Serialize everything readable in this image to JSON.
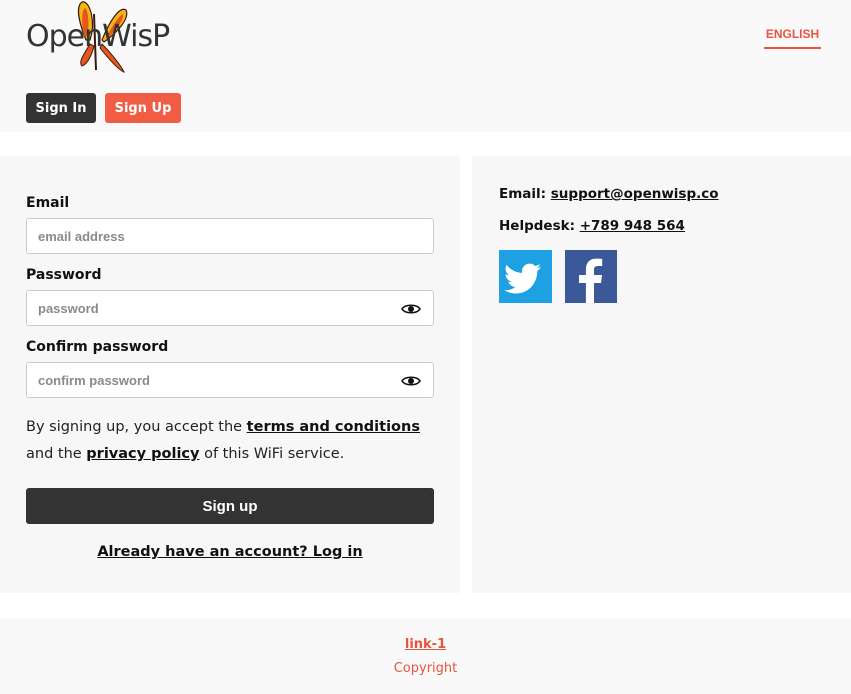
{
  "header": {
    "logo_text": "OpenWisP",
    "language": "ENGLISH",
    "nav": {
      "signin": "Sign In",
      "signup": "Sign Up"
    }
  },
  "form": {
    "email": {
      "label": "Email",
      "placeholder": "email address"
    },
    "password": {
      "label": "Password",
      "placeholder": "password"
    },
    "confirm": {
      "label": "Confirm password",
      "placeholder": "confirm password"
    },
    "terms": {
      "prefix": "By signing up, you accept the ",
      "terms_link": "terms and conditions",
      "middle": " and the ",
      "privacy_link": "privacy policy",
      "suffix": " of this WiFi service."
    },
    "submit": "Sign up",
    "login_link": "Already have an account? Log in"
  },
  "contact": {
    "email_label": "Email:",
    "email_value": "support@openwisp.co",
    "helpdesk_label": "Helpdesk:",
    "helpdesk_value": "+789 948 564",
    "social": {
      "twitter_icon": "twitter-icon",
      "facebook_icon": "facebook-icon"
    }
  },
  "footer": {
    "link": "link-1",
    "copyright": "Copyright"
  },
  "colors": {
    "accent": "#f05c44",
    "dark": "#333333",
    "twitter": "#1da1e2",
    "facebook": "#3b5998"
  }
}
